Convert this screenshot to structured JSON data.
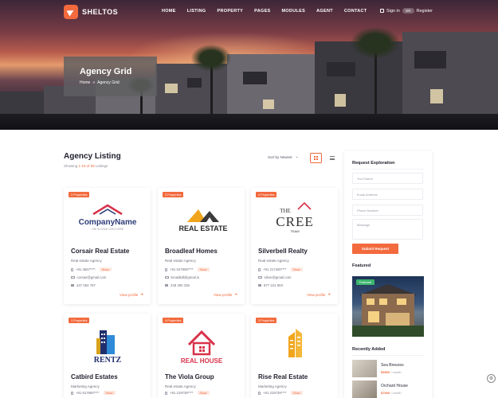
{
  "nav": {
    "brand": "SHELTOS",
    "items": [
      "HOME",
      "LISTING",
      "PROPERTY",
      "PAGES",
      "MODULES",
      "AGENT",
      "CONTACT"
    ],
    "sign_in": "Sign in",
    "or": "OR",
    "register": "Register"
  },
  "hero": {
    "title": "Agency Grid",
    "breadcrumb": [
      "Home",
      "»",
      "Agency Grid"
    ]
  },
  "listing": {
    "title": "Agency Listing",
    "showing_prefix": "Showing ",
    "showing_range": "1-15 of 69",
    "showing_suffix": " Listings",
    "sort_label": "Sort by Newest"
  },
  "agencies": [
    {
      "badge": "2 Properties",
      "name": "Corsair Real Estate",
      "type": "Real estate Agency",
      "phone": "+91 4567****",
      "show": "Show",
      "email": "corsair@gmail.com",
      "fax": "247 054 787",
      "view": "View profile",
      "logo": "companyname"
    },
    {
      "badge": "3 Properties",
      "name": "Broadleaf Homes",
      "type": "Real estate Agency",
      "phone": "+91 547908****",
      "show": "Show",
      "email": "broadkdl@gmail.in",
      "fax": "248 300 335",
      "view": "View profile",
      "logo": "realestate"
    },
    {
      "badge": "4 Properties",
      "name": "Silverbell Realty",
      "type": "Real estate Agency",
      "phone": "+91 217400****",
      "show": "Show",
      "email": "silver@gmail.com",
      "fax": "877 241 903",
      "view": "View profile",
      "logo": "cree"
    },
    {
      "badge": "1 Properties",
      "name": "Catbird Estates",
      "type": "Marketing Agency",
      "phone": "+91 517660****",
      "show": "Show",
      "logo": "rentz"
    },
    {
      "badge": "4 Properties",
      "name": "The Viola Group",
      "type": "Real estate Agency",
      "phone": "+91 219739****",
      "show": "Show",
      "logo": "realhouse"
    },
    {
      "badge": "3 Properties",
      "name": "Rise Real Estate",
      "type": "Marketing Agency",
      "phone": "+91 219739****",
      "show": "Show",
      "logo": "rise"
    }
  ],
  "logos": {
    "companyname": {
      "main": "CompanyName",
      "tag": "THE SLOGAN GOES HERE"
    },
    "realestate": {
      "main": "REAL ESTATE"
    },
    "cree": {
      "the": "THE",
      "main": "CREE",
      "team": "TEAM"
    },
    "rentz": {
      "main": "RENTZ"
    },
    "realhouse": {
      "main": "REAL HOUSE"
    }
  },
  "sidebar": {
    "request_title": "Request Exploration",
    "fields": [
      "Your Name",
      "Email Address",
      "Phone Number",
      "Message"
    ],
    "submit": "Submit Request",
    "featured_title": "Featured",
    "featured_badge": "Featured",
    "recent_title": "Recently Added",
    "recent": [
      {
        "name": "Sea Breezes",
        "price": "$9500",
        "per": " / month"
      },
      {
        "name": "Orchard House",
        "price": "$7600",
        "per": " / month"
      }
    ]
  },
  "colors": {
    "accent": "#f26a3d",
    "text": "#1f1f2e",
    "green_badge": "#3cb46e"
  }
}
